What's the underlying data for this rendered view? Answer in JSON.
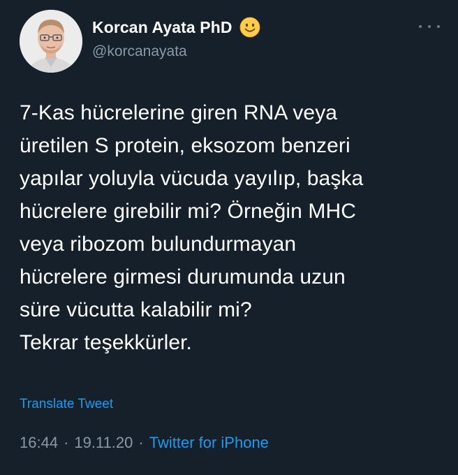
{
  "author": {
    "display_name": "Korcan Ayata PhD",
    "emoji": "smiling-face-emoji",
    "handle": "@korcanayata"
  },
  "more_icon": "more-horizontal-icon",
  "tweet": {
    "text": "7-Kas hücrelerine giren RNA veya\nüretilen S protein, eksozom benzeri\nyapılar yoluyla vücuda yayılıp, başka\nhücrelere girebilir mi? Örneğin MHC\nveya ribozom bulundurmayan\nhücrelere girmesi durumunda uzun\nsüre vücutta kalabilir mi?\nTekrar teşekkürler.",
    "translate_label": "Translate Tweet",
    "time": "16:44",
    "date": "19.11.20",
    "separator": "·",
    "client": "Twitter for iPhone"
  },
  "colors": {
    "background": "#15202b",
    "text": "#ffffff",
    "secondary": "#8b98a5",
    "accent": "#1d9bf0"
  }
}
